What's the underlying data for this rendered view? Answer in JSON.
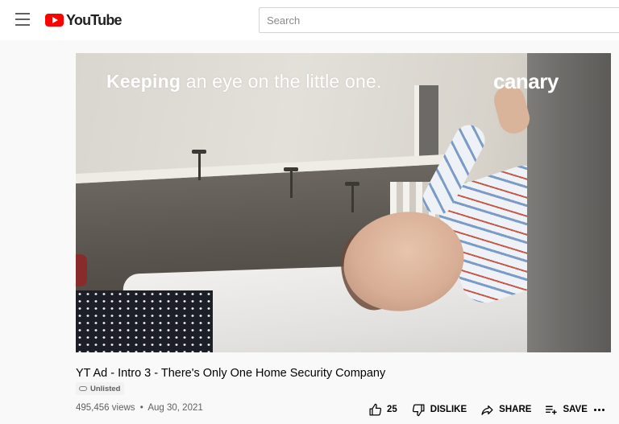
{
  "header": {
    "logo_text": "YouTube",
    "search_placeholder": "Search"
  },
  "video": {
    "overlay_text_bold": "Keeping",
    "overlay_text_rest": " an eye on the little one.",
    "brand_watermark": "canary"
  },
  "details": {
    "title": "YT Ad - Intro 3 - There's Only One Home Security Company",
    "visibility_badge": "Unlisted",
    "views": "495,456 views",
    "separator": "•",
    "date": "Aug 30, 2021"
  },
  "actions": {
    "like_count": "25",
    "dislike_label": "DISLIKE",
    "share_label": "SHARE",
    "save_label": "SAVE"
  },
  "icons": {
    "menu": "menu-icon",
    "logo": "youtube-logo-icon",
    "unlisted": "link-icon",
    "like": "thumbs-up-icon",
    "dislike": "thumbs-down-icon",
    "share": "share-arrow-icon",
    "save": "playlist-add-icon",
    "more": "more-horizontal-icon"
  },
  "colors": {
    "brand_red": "#ff0000",
    "background": "#f9f9f9",
    "secondary_text": "#606060"
  }
}
